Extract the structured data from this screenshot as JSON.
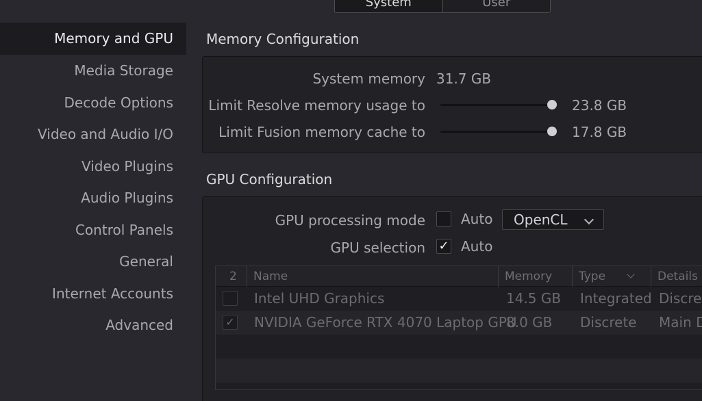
{
  "top_tabs": [
    {
      "label": "System",
      "active": true
    },
    {
      "label": "User",
      "active": false
    }
  ],
  "sidebar": {
    "items": [
      {
        "label": "Memory and GPU",
        "active": true
      },
      {
        "label": "Media Storage"
      },
      {
        "label": "Decode Options"
      },
      {
        "label": "Video and Audio I/O"
      },
      {
        "label": "Video Plugins"
      },
      {
        "label": "Audio Plugins"
      },
      {
        "label": "Control Panels"
      },
      {
        "label": "General"
      },
      {
        "label": "Internet Accounts"
      },
      {
        "label": "Advanced"
      }
    ]
  },
  "memory": {
    "title": "Memory Configuration",
    "system_memory_label": "System memory",
    "system_memory_value": "31.7 GB",
    "resolve_label": "Limit Resolve memory usage to",
    "resolve_value": "23.8 GB",
    "resolve_fraction": 1.0,
    "fusion_label": "Limit Fusion memory cache to",
    "fusion_value": "17.8 GB",
    "fusion_fraction": 1.0
  },
  "gpu": {
    "title": "GPU Configuration",
    "mode_label": "GPU processing mode",
    "mode_auto_label": "Auto",
    "mode_auto_checked": false,
    "mode_dropdown": "OpenCL",
    "selection_label": "GPU selection",
    "selection_auto_label": "Auto",
    "selection_auto_checked": true,
    "selection_check": "✓",
    "table": {
      "count": "2",
      "headers": {
        "name": "Name",
        "memory": "Memory",
        "type": "Type",
        "details": "Details"
      },
      "rows": [
        {
          "checked": false,
          "check": "",
          "name": "Intel UHD Graphics",
          "memory": "14.5 GB",
          "type": "Integrated",
          "details": "Discrete"
        },
        {
          "checked": true,
          "check": "✓",
          "name": "NVIDIA GeForce RTX 4070 Laptop GPU",
          "memory": "8.0 GB",
          "type": "Discrete",
          "details": "Main D"
        }
      ]
    }
  }
}
